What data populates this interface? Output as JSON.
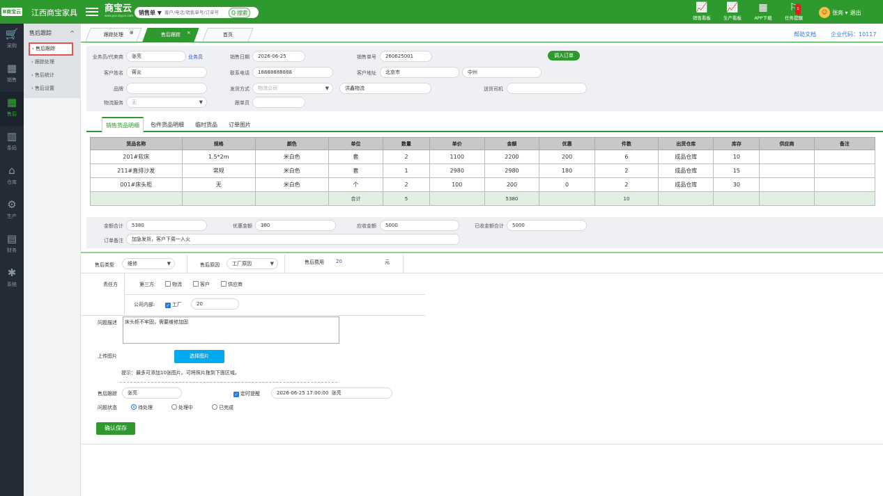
{
  "topbar": {
    "logo": "B商宝云",
    "company": "江西商宝家具",
    "brand": "商宝云",
    "brand_url": "www.pos.sbyun.com",
    "search_type": "销售单 ▼",
    "search_placeholder": "客户/电话/销售单号/订单号",
    "search_button": "Q 搜索",
    "icons": [
      {
        "label": "销售看板",
        "icon": "chart-icon"
      },
      {
        "label": "生产看板",
        "icon": "chart-icon"
      },
      {
        "label": "APP下载",
        "icon": "qr-icon"
      },
      {
        "label": "任务提醒",
        "icon": "flag-icon",
        "badge": "1"
      }
    ],
    "user": "张亮 ▾",
    "logout": "退出"
  },
  "leftbar": [
    {
      "label": "采购",
      "icon": "cart-icon"
    },
    {
      "label": "销售",
      "icon": "grid-icon"
    },
    {
      "label": "售后",
      "icon": "grid-icon",
      "active": true
    },
    {
      "label": "条码",
      "icon": "barcode-icon"
    },
    {
      "label": "仓库",
      "icon": "warehouse-icon"
    },
    {
      "label": "生产",
      "icon": "robot-icon"
    },
    {
      "label": "财务",
      "icon": "calculator-icon"
    },
    {
      "label": "系统",
      "icon": "gear-icon"
    }
  ],
  "submenu": {
    "title": "售后跟踪",
    "items": [
      "› 售后跟踪",
      "› 跟踪处理",
      "› 售后统计",
      "› 售后设置"
    ]
  },
  "tabs": [
    {
      "label": "跟踪处理"
    },
    {
      "label": "售后跟踪",
      "active": true
    },
    {
      "label": "首页"
    }
  ],
  "help": {
    "doc": "帮助文档",
    "company_code": "企业代码：10117"
  },
  "order": {
    "labels": {
      "salesperson": "业务员/代卖商",
      "date": "销售日期",
      "order_no": "销售单号",
      "customer": "客户姓名",
      "phone": "联系电话",
      "address": "客户地址",
      "brand": "品牌",
      "ship_method": "发货方式",
      "driver": "送货司机",
      "logistics": "物流服务",
      "follower": "跟单员"
    },
    "salesperson": "张亮",
    "salesperson_link": "业务员",
    "date": "2026-06-25",
    "order_no": "260625001",
    "import_button": "调入订单",
    "customer": "蒋炎",
    "phone": "18888888888",
    "address_city": "北京市",
    "address_detail": "中州",
    "brand": "",
    "ship_method": "物流公司",
    "logistics_company": "洪鑫物流",
    "driver": "",
    "logistics": "无",
    "follower": ""
  },
  "subtabs": [
    "销售货品明细",
    "包件货品明细",
    "临时货品",
    "订单图片"
  ],
  "goods_table": {
    "headers": [
      "货品名称",
      "规格",
      "颜色",
      "单位",
      "数量",
      "单价",
      "金额",
      "优惠",
      "件数",
      "出货仓库",
      "库存",
      "供应商",
      "备注"
    ],
    "rows": [
      [
        "201#软床",
        "1.5*2m",
        "米白色",
        "套",
        "2",
        "1100",
        "2200",
        "200",
        "6",
        "成品仓库",
        "10",
        "",
        ""
      ],
      [
        "211#直排沙发",
        "常规",
        "米白色",
        "套",
        "1",
        "2980",
        "2980",
        "180",
        "2",
        "成品仓库",
        "15",
        "",
        ""
      ],
      [
        "001#床头柜",
        "无",
        "米白色",
        "个",
        "2",
        "100",
        "200",
        "0",
        "2",
        "成品仓库",
        "30",
        "",
        ""
      ]
    ],
    "summary": {
      "label": "合计",
      "qty": "5",
      "amount": "5380",
      "pieces": "10"
    }
  },
  "totals": {
    "labels": {
      "amount": "金额合计",
      "discount": "优惠金额",
      "receivable": "应收金额",
      "received": "已收金额合计",
      "note": "订单备注"
    },
    "amount": "5380",
    "discount": "380",
    "receivable": "5000",
    "received": "5000",
    "note": "加急发货，客户下周一入火"
  },
  "aftersales": {
    "labels": {
      "type": "售后类型",
      "reason": "售后原因",
      "fee": "售后费用",
      "fee_unit": "元",
      "responsible": "责任方",
      "third_party": "第三方:",
      "internal": "公司内部:",
      "problem": "问题描述",
      "upload": "上传图片",
      "tracker": "售后跟踪",
      "status": "问题状态"
    },
    "type": "维修",
    "reason": "工厂原因",
    "fee": "20",
    "third_party_options": [
      {
        "label": "物流",
        "checked": false
      },
      {
        "label": "客户",
        "checked": false
      },
      {
        "label": "供应商",
        "checked": false
      }
    ],
    "internal_option": {
      "label": "工厂",
      "checked": true
    },
    "internal_amount": "20",
    "problem": "床头柜不牢固，需要维修加固",
    "upload_button": "选择图片",
    "upload_hint": "提示：最多可添加10张图片。可将照片拖到下面区域。",
    "tracker": "张亮",
    "reminder_label": "定时提醒",
    "reminder_checked": true,
    "reminder_time": "2026-06-25 17:00:00",
    "reminder_person": "张亮",
    "status_options": [
      {
        "label": "待处理",
        "checked": true
      },
      {
        "label": "处理中",
        "checked": false
      },
      {
        "label": "已完成",
        "checked": false
      }
    ],
    "save_button": "确认保存"
  }
}
